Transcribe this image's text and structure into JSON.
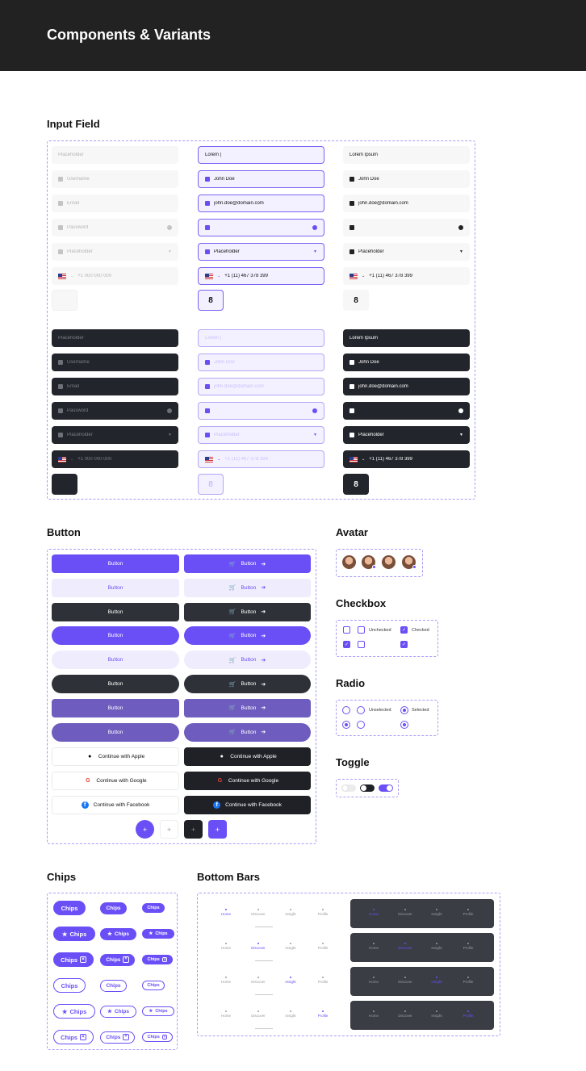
{
  "page_title": "Components & Variants",
  "sections": {
    "input": "Input Field",
    "button": "Button",
    "avatar": "Avatar",
    "checkbox": "Checkbox",
    "radio": "Radio",
    "toggle": "Toggle",
    "chips": "Chips",
    "bottom_bars": "Bottom Bars"
  },
  "inputs": {
    "placeholder": "Placeholder",
    "lorem_cursor": "Lorem |",
    "lorem": "Lorem Ipsum",
    "username": "Username",
    "john": "John Doe",
    "email": "Email",
    "email_value": "john.doe@domain.com",
    "password": "Password",
    "phone_ph": "+1 000 000 000",
    "phone_value": "+1 (11) 467 378 399",
    "otp": "8"
  },
  "buttons": {
    "label": "Button",
    "apple": "Continue with Apple",
    "google": "Continue with Google",
    "facebook": "Continue with Facebook",
    "plus": "+"
  },
  "checkbox": {
    "unchecked": "Unchecked",
    "checked": "Checked"
  },
  "radio": {
    "unselected": "Unselected",
    "selected": "Selected"
  },
  "chips": {
    "label": "Chips"
  },
  "nav": {
    "home": "Home",
    "discover": "Discover",
    "insight": "Insight",
    "profile": "Profile"
  },
  "colors": {
    "accent": "#6a4ff7",
    "dark": "#22252b",
    "header": "#222222"
  }
}
